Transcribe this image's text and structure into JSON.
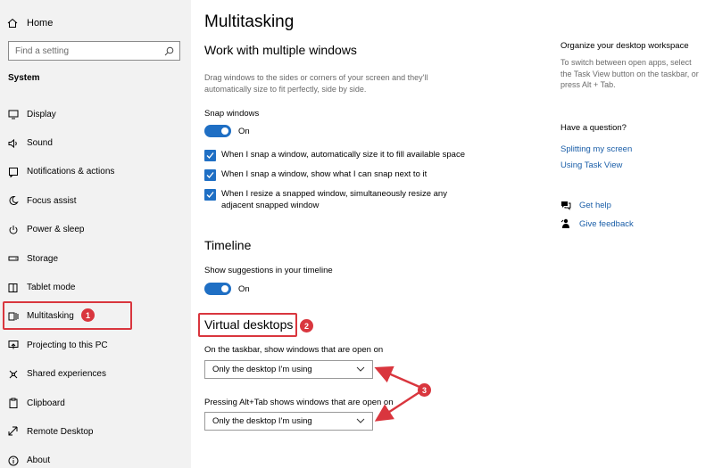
{
  "sidebar": {
    "home_label": "Home",
    "search_placeholder": "Find a setting",
    "section_title": "System",
    "items": [
      {
        "label": "Display",
        "icon": "display-icon"
      },
      {
        "label": "Sound",
        "icon": "speaker-icon"
      },
      {
        "label": "Notifications & actions",
        "icon": "notification-icon"
      },
      {
        "label": "Focus assist",
        "icon": "moon-icon"
      },
      {
        "label": "Power & sleep",
        "icon": "power-icon"
      },
      {
        "label": "Storage",
        "icon": "storage-icon"
      },
      {
        "label": "Tablet mode",
        "icon": "tablet-icon"
      },
      {
        "label": "Multitasking",
        "icon": "multitasking-icon"
      },
      {
        "label": "Projecting to this PC",
        "icon": "projector-icon"
      },
      {
        "label": "Shared experiences",
        "icon": "share-icon"
      },
      {
        "label": "Clipboard",
        "icon": "clipboard-icon"
      },
      {
        "label": "Remote Desktop",
        "icon": "remote-desktop-icon"
      },
      {
        "label": "About",
        "icon": "info-icon"
      }
    ]
  },
  "main": {
    "page_title": "Multitasking",
    "windows_section": {
      "title": "Work with multiple windows",
      "description": "Drag windows to the sides or corners of your screen and they'll automatically size to fit perfectly, side by side.",
      "snap_label": "Snap windows",
      "snap_toggle_state": "On",
      "checkboxes": [
        {
          "label": "When I snap a window, automatically size it to fill available space",
          "checked": true
        },
        {
          "label": "When I snap a window, show what I can snap next to it",
          "checked": true
        },
        {
          "label": "When I resize a snapped window, simultaneously resize any adjacent snapped window",
          "checked": true
        }
      ]
    },
    "timeline_section": {
      "title": "Timeline",
      "suggestions_label": "Show suggestions in your timeline",
      "toggle_state": "On"
    },
    "virtual_desktops_section": {
      "title": "Virtual desktops",
      "taskbar_label": "On the taskbar, show windows that are open on",
      "taskbar_value": "Only the desktop I'm using",
      "alttab_label": "Pressing Alt+Tab shows windows that are open on",
      "alttab_value": "Only the desktop I'm using"
    }
  },
  "right_panel": {
    "organize_title": "Organize your desktop workspace",
    "organize_desc": "To switch between open apps, select the Task View button on the taskbar, or press Alt + Tab.",
    "question_title": "Have a question?",
    "links": [
      "Splitting my screen",
      "Using Task View"
    ],
    "get_help": "Get help",
    "give_feedback": "Give feedback"
  },
  "annotations": {
    "badge_1": "1",
    "badge_2": "2",
    "badge_3": "3",
    "color": "#d9363e"
  },
  "colors": {
    "accent": "#1f6fc4",
    "link": "#1a5ea8",
    "sidebar_bg": "#f2f2f2"
  }
}
